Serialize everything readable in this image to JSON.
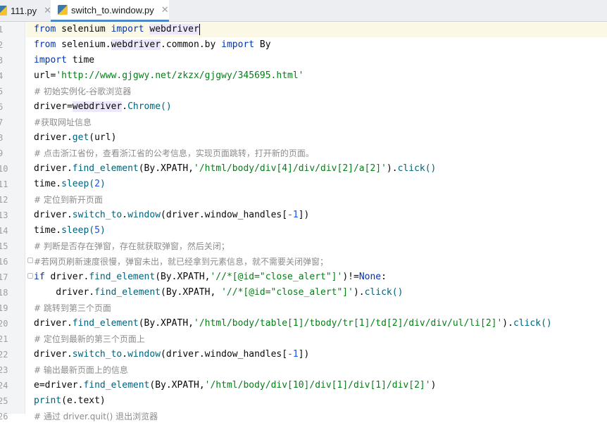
{
  "tabs": [
    {
      "name": "111.py",
      "active": false
    },
    {
      "name": "switch_to.window.py",
      "active": true
    }
  ],
  "line_numbers": [
    "1",
    "2",
    "3",
    "4",
    "5",
    "6",
    "7",
    "8",
    "9",
    "10",
    "11",
    "12",
    "13",
    "14",
    "15",
    "16",
    "17",
    "18",
    "19",
    "20",
    "21",
    "22",
    "23",
    "24",
    "25",
    "26"
  ],
  "code": {
    "l1": [
      "from",
      " selenium ",
      "import",
      " ",
      "webdriver"
    ],
    "l2": [
      "from",
      " selenium.",
      "webdriver",
      ".common.by ",
      "import",
      " By"
    ],
    "l3": [
      "import",
      " time"
    ],
    "l4": [
      "url=",
      "'http://www.gjgwy.net/zkzx/gjgwy/345695.html'"
    ],
    "l5": "# 初始实例化-谷歌浏览器",
    "l6": [
      "driver=",
      "webdriver",
      ".",
      "Chrome",
      "()"
    ],
    "l7": "#获取网址信息",
    "l8": [
      "driver.",
      "get",
      "(url)"
    ],
    "l9": "# 点击浙江省份，查看浙江省的公考信息，实现页面跳转，打开新的页面。",
    "l10": [
      "driver.",
      "find_element",
      "(By.XPATH,",
      "'/html/body/div[4]/div/div[2]/a[2]'",
      ").",
      "click",
      "()"
    ],
    "l11": [
      "time.",
      "sleep",
      "(",
      "2",
      ")"
    ],
    "l12": "# 定位到新开页面",
    "l13": [
      "driver.",
      "switch_to",
      ".",
      "window",
      "(driver.window_handles[",
      "-1",
      "])"
    ],
    "l14": [
      "time.",
      "sleep",
      "(",
      "5",
      ")"
    ],
    "l15": "# 判断是否存在弹窗，存在就获取弹窗，然后关闭；",
    "l16": "#若网页刷新速度很慢，弹窗未出，就已经拿到元素信息，就不需要关闭弹窗；",
    "l17": [
      "if",
      " driver.",
      "find_element",
      "(By.XPATH,",
      "'//*[@id=\"close_alert\"]'",
      ")!=",
      "None",
      ":"
    ],
    "l18": [
      "    driver.",
      "find_element",
      "(By.XPATH, ",
      "'//*[@id=\"close_alert\"]'",
      ").",
      "click",
      "()"
    ],
    "l19": "# 跳转到第三个页面",
    "l20": [
      "driver.",
      "find_element",
      "(By.XPATH,",
      "'/html/body/table[1]/tbody/tr[1]/td[2]/div/div/ul/li[2]'",
      ").",
      "click",
      "()"
    ],
    "l21": "# 定位到最新的第三个页面上",
    "l22": [
      "driver.",
      "switch_to",
      ".",
      "window",
      "(driver.window_handles[",
      "-1",
      "])"
    ],
    "l23": "# 输出最新页面上的信息",
    "l24": [
      "e=driver.",
      "find_element",
      "(By.XPATH,",
      "'/html/body/div[10]/div[1]/div[1]/div[2]'",
      ")"
    ],
    "l25": [
      "print",
      "(e.text)"
    ],
    "l26": "# 通过 driver.quit() 退出浏览器"
  }
}
